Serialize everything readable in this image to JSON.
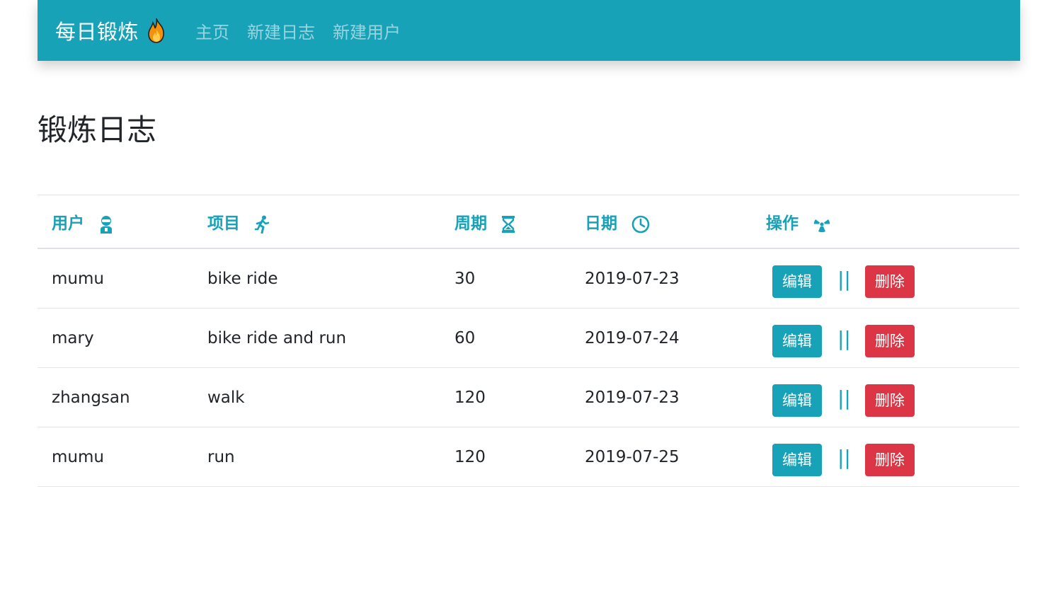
{
  "navbar": {
    "brand": "每日锻炼",
    "brand_icon": "fire-icon",
    "links": [
      "主页",
      "新建日志",
      "新建用户"
    ]
  },
  "page": {
    "title": "锻炼日志"
  },
  "table": {
    "headers": [
      {
        "label": "用户",
        "icon": "user-icon"
      },
      {
        "label": "项目",
        "icon": "running-icon"
      },
      {
        "label": "周期",
        "icon": "hourglass-icon"
      },
      {
        "label": "日期",
        "icon": "clock-icon"
      },
      {
        "label": "操作",
        "icon": "radiation-icon"
      }
    ],
    "rows": [
      {
        "user": "mumu",
        "item": "bike ride",
        "duration": "30",
        "date": "2019-07-23"
      },
      {
        "user": "mary",
        "item": "bike ride and run",
        "duration": "60",
        "date": "2019-07-24"
      },
      {
        "user": "zhangsan",
        "item": "walk",
        "duration": "120",
        "date": "2019-07-23"
      },
      {
        "user": "mumu",
        "item": "run",
        "duration": "120",
        "date": "2019-07-25"
      }
    ],
    "edit_label": "编辑",
    "separator": "||",
    "delete_label": "删除"
  },
  "colors": {
    "primary": "#17a2b8",
    "danger": "#dc3545",
    "text": "#212529"
  }
}
